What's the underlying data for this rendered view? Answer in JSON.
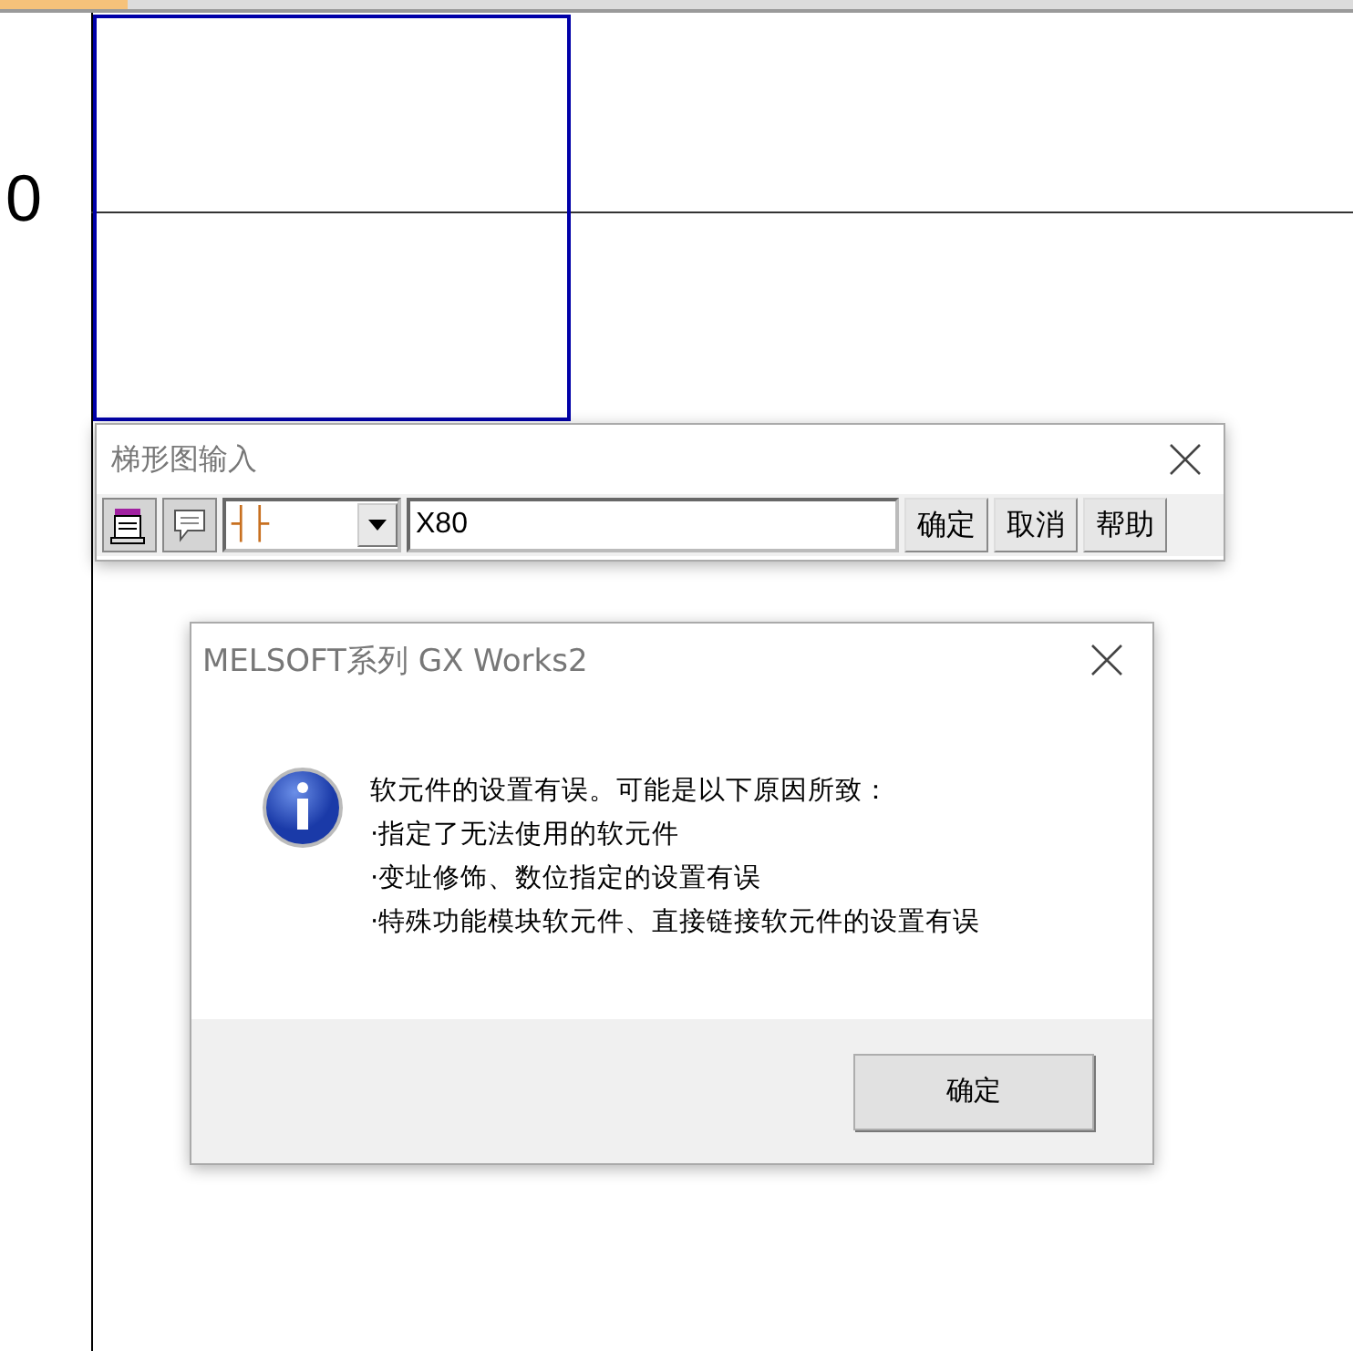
{
  "ladder": {
    "row_numbers": [
      "0"
    ]
  },
  "ladder_input": {
    "title": "梯形图输入",
    "instruction_select": {
      "value": "┤├"
    },
    "device_field": {
      "value": "X80"
    },
    "buttons": [
      "确定",
      "取消",
      "帮助"
    ]
  },
  "message_dialog": {
    "title": "MELSOFT系列 GX Works2",
    "message_lines": [
      "软元件的设置有误。可能是以下原因所致：",
      "·指定了无法使用的软元件",
      "·变址修饰、数位指定的设置有误",
      "·特殊功能模块软元件、直接链接软元件的设置有误"
    ],
    "buttons": [
      "确定"
    ]
  }
}
